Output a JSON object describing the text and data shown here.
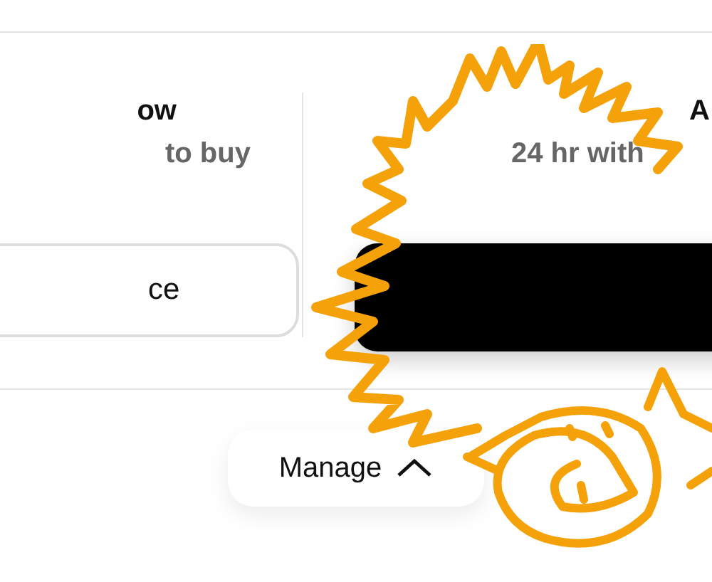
{
  "left_panel": {
    "title": "ow",
    "subtitle": "to buy",
    "button": "ce"
  },
  "right_panel": {
    "title": "A",
    "subtitle": "24 hr with"
  },
  "manage_toggle": {
    "label": "Manage",
    "expanded": true
  }
}
